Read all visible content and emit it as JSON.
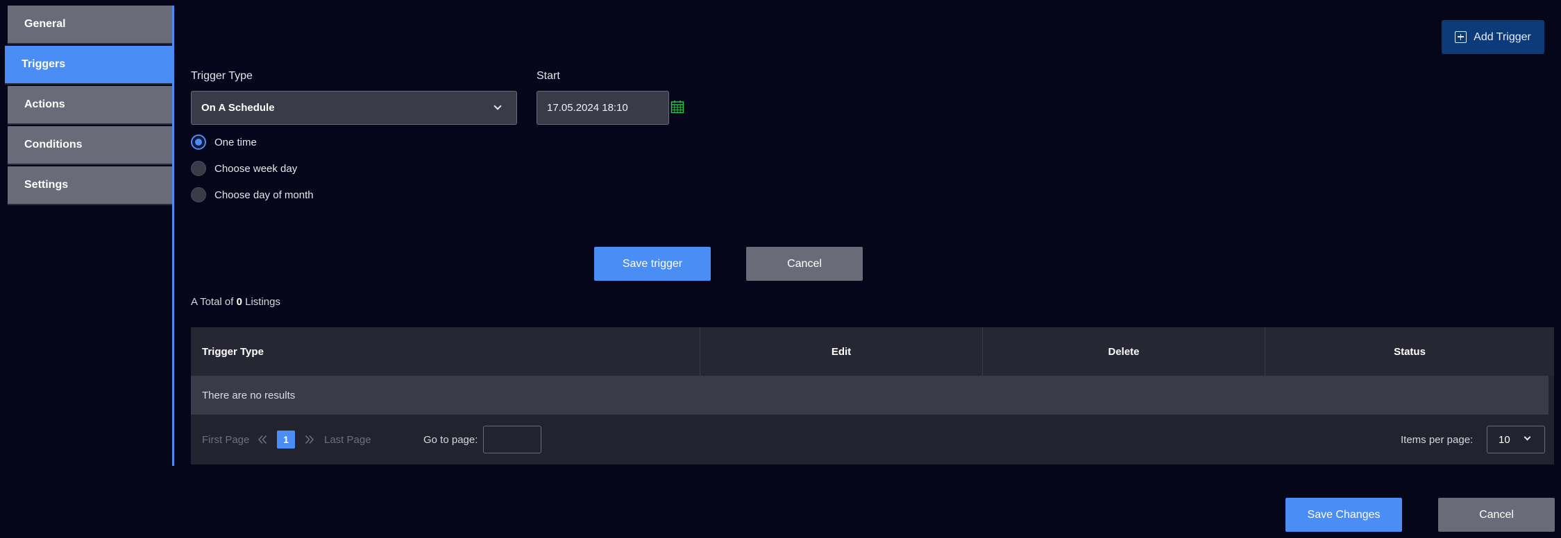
{
  "sidebar": {
    "items": [
      {
        "label": "General"
      },
      {
        "label": "Triggers"
      },
      {
        "label": "Actions"
      },
      {
        "label": "Conditions"
      },
      {
        "label": "Settings"
      }
    ],
    "active_index": 1
  },
  "header": {
    "add_trigger_label": "Add Trigger",
    "add_trigger_icon": "plus-square-icon"
  },
  "form": {
    "trigger_type_label": "Trigger Type",
    "trigger_type_value": "On A Schedule",
    "start_label": "Start",
    "start_value": "17.05.2024 18:10",
    "calendar_icon": "calendar-icon",
    "radios": [
      {
        "label": "One time",
        "checked": true
      },
      {
        "label": "Choose week day",
        "checked": false
      },
      {
        "label": "Choose day of month",
        "checked": false
      }
    ],
    "save_trigger_label": "Save trigger",
    "cancel_label": "Cancel"
  },
  "listing": {
    "total_prefix": "A Total of",
    "total_count": "0",
    "total_suffix": "Listings",
    "columns": [
      "Trigger Type",
      "Edit",
      "Delete",
      "Status"
    ],
    "empty_text": "There are no results",
    "pager": {
      "first_page": "First Page",
      "last_page": "Last Page",
      "current_page": "1",
      "goto_label": "Go to page:",
      "goto_value": "",
      "items_per_page_label": "Items per page:",
      "items_per_page_value": "10"
    }
  },
  "footer": {
    "save_changes_label": "Save Changes",
    "cancel_label": "Cancel"
  },
  "colors": {
    "background": "#05061a",
    "accent": "#4a8df5",
    "add_trigger_bg": "#0d3a78",
    "calendar_icon": "#2fbf4a",
    "secondary_button": "#6a6b78"
  }
}
